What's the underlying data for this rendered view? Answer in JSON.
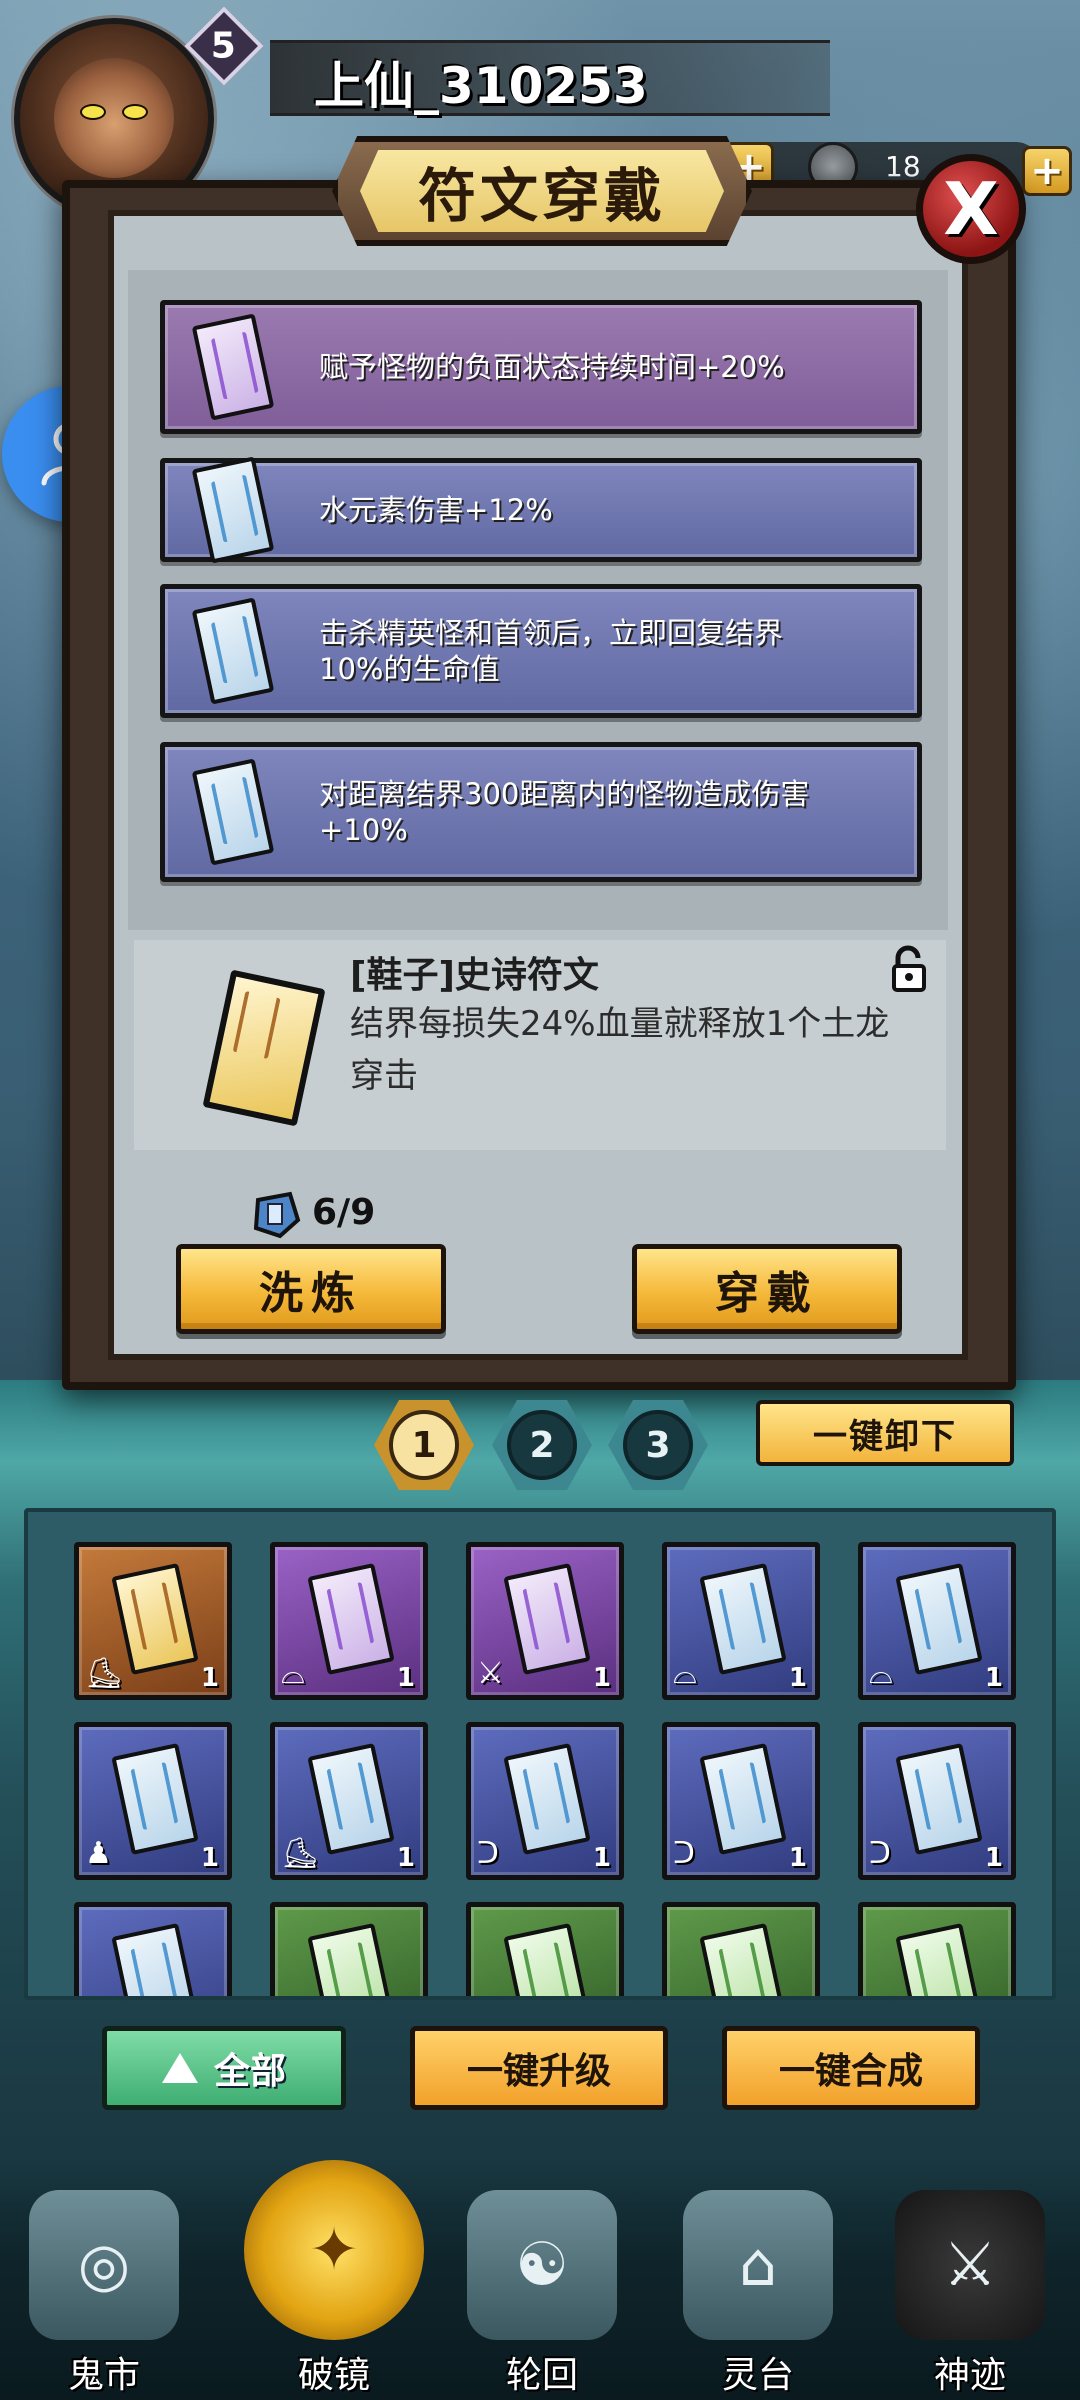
{
  "player": {
    "name": "上仙_310253",
    "level": "5",
    "resource_count": "18"
  },
  "dialog": {
    "title": "符文穿戴",
    "close_label": "X",
    "stats": [
      {
        "text": "赋予怪物的负面状态持续时间+20%",
        "rarity": "purple"
      },
      {
        "text": "水元素伤害+12%",
        "rarity": "blue"
      },
      {
        "text": "击杀精英怪和首领后，立即回复结界10%的生命值",
        "rarity": "blue"
      },
      {
        "text": "对距离结界300距离内的怪物造成伤害+10%",
        "rarity": "blue"
      }
    ],
    "rune": {
      "title": "[鞋子]史诗符文",
      "description": "结界每损失24%血量就释放1个土龙穿击"
    },
    "wash_count": "6/9",
    "wash_button": "洗炼",
    "equip_button": "穿戴"
  },
  "tabs": [
    "1",
    "2",
    "3"
  ],
  "unequip_button": "一键卸下",
  "inventory": [
    {
      "rarity": "gold",
      "type": "boot",
      "count": "1"
    },
    {
      "rarity": "purple",
      "type": "hat",
      "count": "1"
    },
    {
      "rarity": "purple",
      "type": "sword",
      "count": "1"
    },
    {
      "rarity": "blue",
      "type": "hat",
      "count": "1"
    },
    {
      "rarity": "blue",
      "type": "hat",
      "count": "1"
    },
    {
      "rarity": "blue",
      "type": "armor",
      "count": "1"
    },
    {
      "rarity": "blue",
      "type": "boot",
      "count": "1"
    },
    {
      "rarity": "blue",
      "type": "ring",
      "count": "1"
    },
    {
      "rarity": "blue",
      "type": "ring",
      "count": "1"
    },
    {
      "rarity": "blue",
      "type": "ring",
      "count": "1"
    },
    {
      "rarity": "blue",
      "type": "",
      "count": ""
    },
    {
      "rarity": "green",
      "type": "",
      "count": ""
    },
    {
      "rarity": "green",
      "type": "",
      "count": ""
    },
    {
      "rarity": "green",
      "type": "",
      "count": ""
    },
    {
      "rarity": "green",
      "type": "",
      "count": ""
    }
  ],
  "actions": {
    "filter_all": "全部",
    "upgrade_all": "一键升级",
    "merge_all": "一键合成"
  },
  "nav": [
    {
      "label": "鬼市",
      "icon": "market-icon"
    },
    {
      "label": "破镜",
      "icon": "break-mirror-icon"
    },
    {
      "label": "轮回",
      "icon": "yin-yang-icon"
    },
    {
      "label": "灵台",
      "icon": "shrine-icon"
    },
    {
      "label": "神迹",
      "icon": "miracle-icon"
    }
  ],
  "colors": {
    "gold": "#f5b93a",
    "purple": "#8a63a8",
    "blue": "#6a72ad",
    "green": "#4f8f40",
    "accent": "#3a8ef0"
  }
}
